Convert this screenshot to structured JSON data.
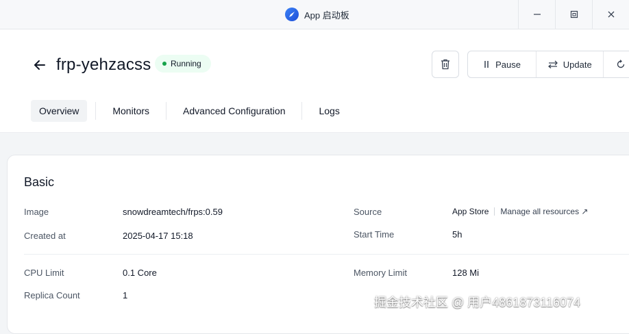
{
  "window": {
    "title": "App 启动板"
  },
  "header": {
    "app_name": "frp-yehzacss",
    "status": "Running",
    "actions": {
      "pause_label": "Pause",
      "update_label": "Update"
    }
  },
  "tabs": [
    {
      "label": "Overview"
    },
    {
      "label": "Monitors"
    },
    {
      "label": "Advanced Configuration"
    },
    {
      "label": "Logs"
    }
  ],
  "basic": {
    "title": "Basic",
    "image_label": "Image",
    "image_value": "snowdreamtech/frps:0.59",
    "created_label": "Created at",
    "created_value": "2025-04-17 15:18",
    "source_label": "Source",
    "source_value": "App Store",
    "manage_link": "Manage all resources ↗",
    "start_time_label": "Start Time",
    "start_time_value": "5h",
    "cpu_label": "CPU Limit",
    "cpu_value": "0.1 Core",
    "memory_label": "Memory Limit",
    "memory_value": "128 Mi",
    "replica_label": "Replica Count",
    "replica_value": "1"
  },
  "watermark": "掘金技术社区 @ 用户4861873116074",
  "colors": {
    "status_green": "#16a34a",
    "status_bg": "#ecfdf3",
    "accent_blue": "#3b82f6"
  }
}
